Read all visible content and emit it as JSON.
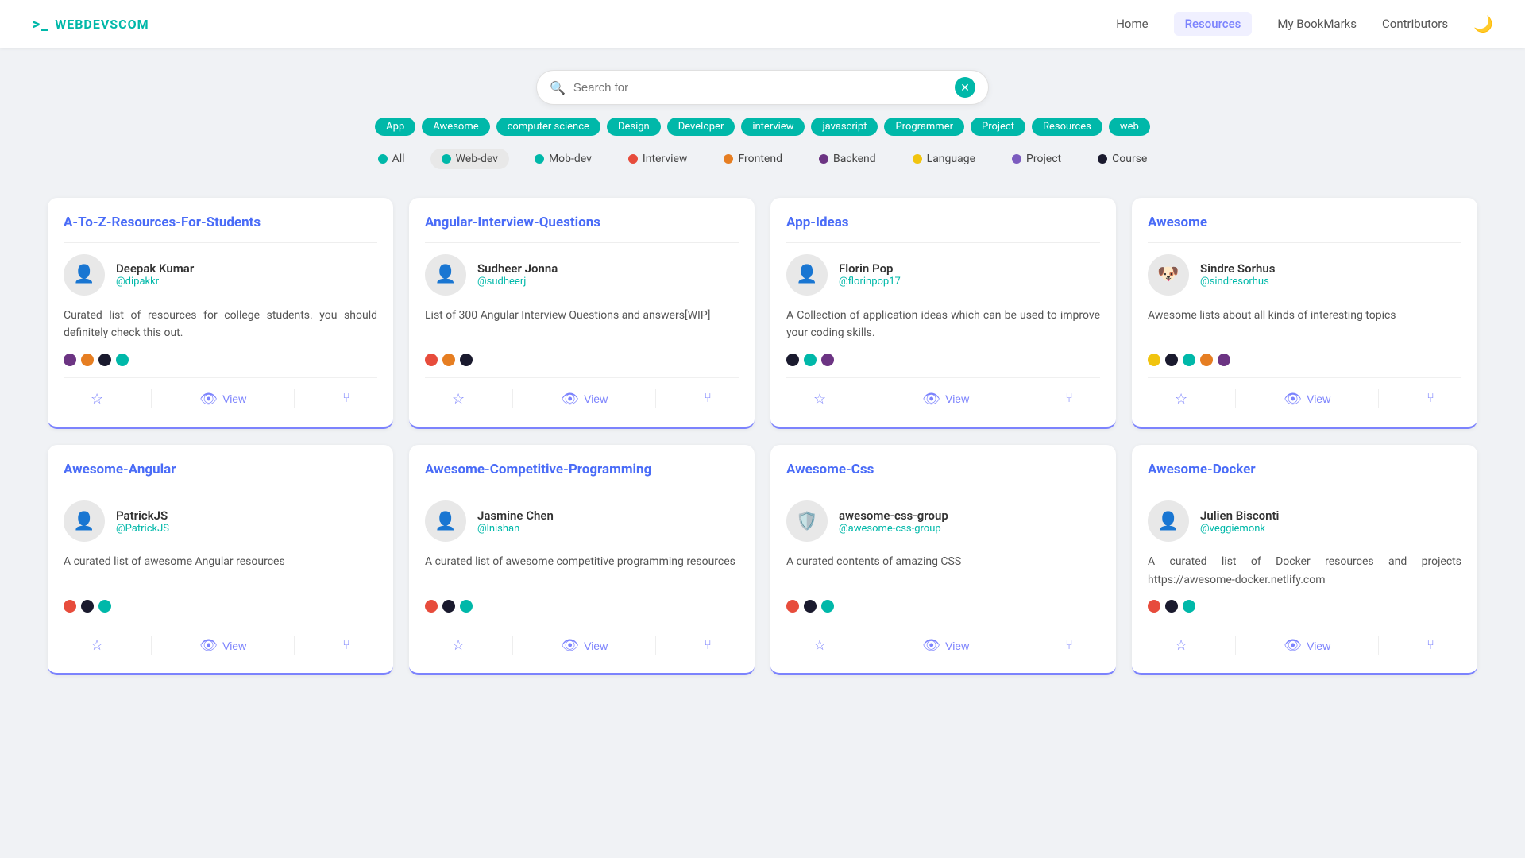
{
  "header": {
    "logo_icon": ">_",
    "logo_text": "WEBDEVSCOM",
    "nav": [
      {
        "label": "Home",
        "active": false
      },
      {
        "label": "Resources",
        "active": true
      },
      {
        "label": "My BookMarks",
        "active": false
      },
      {
        "label": "Contributors",
        "active": false
      }
    ],
    "moon_icon": "🌙"
  },
  "search": {
    "placeholder": "Search for",
    "clear_icon": "✕"
  },
  "tags": [
    "App",
    "Awesome",
    "computer science",
    "Design",
    "Developer",
    "interview",
    "javascript",
    "Programmer",
    "Project",
    "Resources",
    "web"
  ],
  "filters": [
    {
      "label": "All",
      "color": "#00b8a9",
      "active": false
    },
    {
      "label": "Web-dev",
      "color": "#00b8a9",
      "active": true
    },
    {
      "label": "Mob-dev",
      "color": "#00b8a9",
      "active": false
    },
    {
      "label": "Interview",
      "color": "#e74c3c",
      "active": false
    },
    {
      "label": "Frontend",
      "color": "#e67e22",
      "active": false
    },
    {
      "label": "Backend",
      "color": "#6c3483",
      "active": false
    },
    {
      "label": "Language",
      "color": "#f1c40f",
      "active": false
    },
    {
      "label": "Project",
      "color": "#7c5cbf",
      "active": false
    },
    {
      "label": "Course",
      "color": "#1a1a2e",
      "active": false
    }
  ],
  "cards": [
    {
      "title": "A-To-Z-Resources-For-Students",
      "author_name": "Deepak Kumar",
      "author_handle": "@dipakkr",
      "author_avatar": "👤",
      "description": "Curated list of resources for college students. you should definitely check this out.",
      "dots": [
        "#6c3483",
        "#e67e22",
        "#1a1a2e",
        "#00b8a9"
      ],
      "view_label": "View"
    },
    {
      "title": "Angular-Interview-Questions",
      "author_name": "Sudheer Jonna",
      "author_handle": "@sudheerj",
      "author_avatar": "👤",
      "description": "List of 300 Angular Interview Questions and answers[WIP]",
      "dots": [
        "#e74c3c",
        "#e67e22",
        "#1a1a2e"
      ],
      "view_label": "View"
    },
    {
      "title": "App-Ideas",
      "author_name": "Florin Pop",
      "author_handle": "@florinpop17",
      "author_avatar": "👤",
      "description": "A Collection of application ideas which can be used to improve your coding skills.",
      "dots": [
        "#1a1a2e",
        "#00b8a9",
        "#6c3483"
      ],
      "view_label": "View"
    },
    {
      "title": "Awesome",
      "author_name": "Sindre Sorhus",
      "author_handle": "@sindresorhus",
      "author_avatar": "🐶",
      "description": "Awesome lists about all kinds of interesting topics",
      "dots": [
        "#f1c40f",
        "#1a1a2e",
        "#00b8a9",
        "#e67e22",
        "#6c3483"
      ],
      "view_label": "View"
    },
    {
      "title": "Awesome-Angular",
      "author_name": "PatrickJS",
      "author_handle": "@PatrickJS",
      "author_avatar": "👤",
      "description": "A curated list of awesome Angular resources",
      "dots": [
        "#e74c3c",
        "#1a1a2e",
        "#00b8a9"
      ],
      "view_label": "View"
    },
    {
      "title": "Awesome-Competitive-Programming",
      "author_name": "Jasmine Chen",
      "author_handle": "@lnishan",
      "author_avatar": "👤",
      "description": "A curated list of awesome competitive programming resources",
      "dots": [
        "#e74c3c",
        "#1a1a2e",
        "#00b8a9"
      ],
      "view_label": "View"
    },
    {
      "title": "Awesome-Css",
      "author_name": "awesome-css-group",
      "author_handle": "@awesome-css-group",
      "author_avatar": "🛡️",
      "description": "A curated contents of amazing CSS",
      "dots": [
        "#e74c3c",
        "#1a1a2e",
        "#00b8a9"
      ],
      "view_label": "View"
    },
    {
      "title": "Awesome-Docker",
      "author_name": "Julien Bisconti",
      "author_handle": "@veggiemonk",
      "author_avatar": "👤",
      "description": "A curated list of Docker resources and projects https://awesome-docker.netlify.com",
      "dots": [
        "#e74c3c",
        "#1a1a2e",
        "#00b8a9"
      ],
      "view_label": "View"
    }
  ],
  "action_icons": {
    "star": "☆",
    "eye": "👁",
    "fork": "⑂"
  }
}
